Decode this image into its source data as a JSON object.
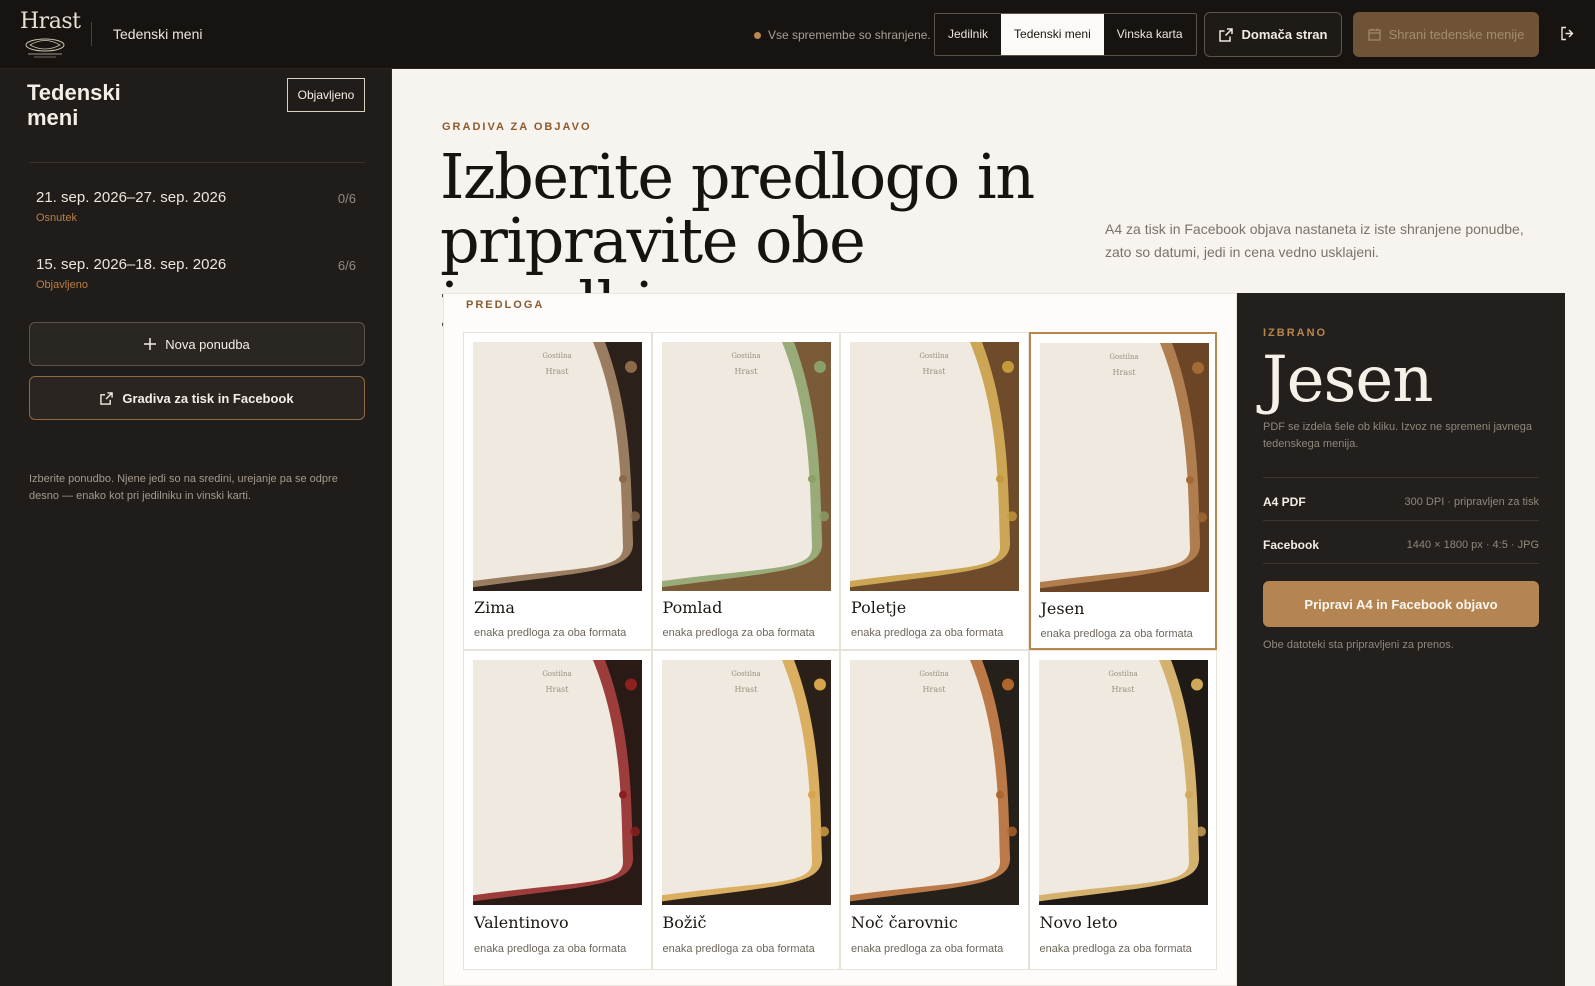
{
  "topbar": {
    "logo": "Hrast",
    "app_title": "Tedenski meni",
    "save_status": "Vse spremembe so shranjene.",
    "tabs": [
      {
        "label": "Jedilnik",
        "active": false
      },
      {
        "label": "Tedenski meni",
        "active": true
      },
      {
        "label": "Vinska karta",
        "active": false
      }
    ],
    "home_button": "Domača stran",
    "save_button": "Shrani tedenske menije",
    "icons": {
      "home": "external-link-icon",
      "save": "calendar-icon",
      "logout": "logout-icon"
    },
    "colors": {
      "status_dot": "#b8874e",
      "save_button_bg": "#6e5336"
    }
  },
  "sidebar": {
    "title": "Tedenski meni",
    "badge": "Objavljeno",
    "weeks": [
      {
        "range": "21. sep. 2026–27. sep. 2026",
        "count": "0/6",
        "state": "Osnutek"
      },
      {
        "range": "15. sep. 2026–18. sep. 2026",
        "count": "6/6",
        "state": "Objavljeno"
      }
    ],
    "new_button": "Nova ponudba",
    "materials_button": "Gradiva za tisk in Facebook",
    "note": "Izberite ponudbo. Njene jedi so na sredini, urejanje pa se odpre desno — enako kot pri jedilniku in vinski karti."
  },
  "main": {
    "eyebrow": "GRADIVA ZA OBJAVO",
    "hero_line1": "Izberite predlogo in",
    "hero_line2": "pripravite obe izvedbi.",
    "hero_sub": "A4 za tisk in Facebook objava nastaneta iz iste shranjene ponudbe, zato so datumi, jedi in cena vedno usklajeni.",
    "panel_label": "PREDLOGA",
    "thumb_logo_line1": "Gostilna",
    "thumb_logo_line2": "Hrast",
    "templates": [
      {
        "name": "Zima",
        "fmt": "enaka predloga za oba formata",
        "selected": false,
        "accent": "#2b211a",
        "deco": "#8b6a4a"
      },
      {
        "name": "Pomlad",
        "fmt": "enaka predloga za oba formata",
        "selected": false,
        "accent": "#7b5a38",
        "deco": "#8aa067"
      },
      {
        "name": "Poletje",
        "fmt": "enaka predloga za oba formata",
        "selected": false,
        "accent": "#6e4b2b",
        "deco": "#c69a3c"
      },
      {
        "name": "Jesen",
        "fmt": "enaka predloga za oba formata",
        "selected": true,
        "accent": "#6b4526",
        "deco": "#a36a35"
      },
      {
        "name": "Valentinovo",
        "fmt": "enaka predloga za oba formata",
        "selected": false,
        "accent": "#2a1a15",
        "deco": "#8e1f1f"
      },
      {
        "name": "Božič",
        "fmt": "enaka predloga za oba formata",
        "selected": false,
        "accent": "#2b2018",
        "deco": "#d7a44b"
      },
      {
        "name": "Noč čarovnic",
        "fmt": "enaka predloga za oba formata",
        "selected": false,
        "accent": "#25201a",
        "deco": "#b0652c"
      },
      {
        "name": "Novo leto",
        "fmt": "enaka predloga za oba formata",
        "selected": false,
        "accent": "#1f1a15",
        "deco": "#cfa85a"
      }
    ]
  },
  "aside": {
    "eyebrow": "IZBRANO",
    "title": "Jesen",
    "desc": "PDF se izdela šele ob kliku. Izvoz ne spremeni javnega tedenskega menija.",
    "rows": [
      {
        "k": "A4 PDF",
        "v": "300 DPI · pripravljen za tisk"
      },
      {
        "k": "Facebook",
        "v": "1440 × 1800 px · 4:5 · JPG"
      }
    ],
    "button": "Pripravi A4 in Facebook objavo",
    "note": "Obe datoteki sta pripravljeni za prenos.",
    "colors": {
      "button": "#b48552",
      "eyebrow": "#b8874e"
    }
  }
}
